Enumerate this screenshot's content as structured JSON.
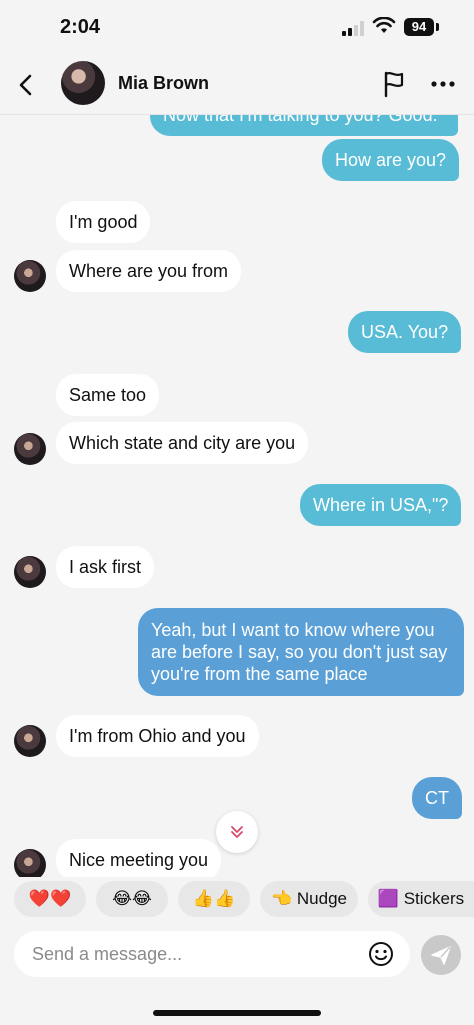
{
  "status_bar": {
    "time": "2:04",
    "battery": "94"
  },
  "header": {
    "contact_name": "Mia Brown"
  },
  "messages": [
    {
      "side": "out",
      "text": "Now that I'm talking to you? Good."
    },
    {
      "side": "out",
      "text": "How are you?"
    },
    {
      "side": "in",
      "text": "I'm good"
    },
    {
      "side": "in",
      "text": "Where are you from"
    },
    {
      "side": "out",
      "text": "USA. You?"
    },
    {
      "side": "in",
      "text": "Same too"
    },
    {
      "side": "in",
      "text": "Which state and city are you"
    },
    {
      "side": "out",
      "text": "Where in USA,\"?"
    },
    {
      "side": "in",
      "text": "I ask first"
    },
    {
      "side": "out",
      "text": "Yeah, but I want to know where you are before I say, so you don't just say you're from the same place"
    },
    {
      "side": "in",
      "text": "I'm from Ohio and you"
    },
    {
      "side": "out",
      "text": "CT"
    },
    {
      "side": "in",
      "text": "Nice meeting you"
    }
  ],
  "reactions": [
    {
      "label": "❤️❤️"
    },
    {
      "label": "😂😂"
    },
    {
      "label": "👍👍"
    },
    {
      "label": "👈 Nudge"
    },
    {
      "label": "🟪 Stickers"
    }
  ],
  "composer": {
    "placeholder": "Send a message..."
  },
  "colors": {
    "accent_out": "#58bcd6",
    "accent_out_long": "#5aa0d6",
    "send_button": "#c9c9c9"
  }
}
